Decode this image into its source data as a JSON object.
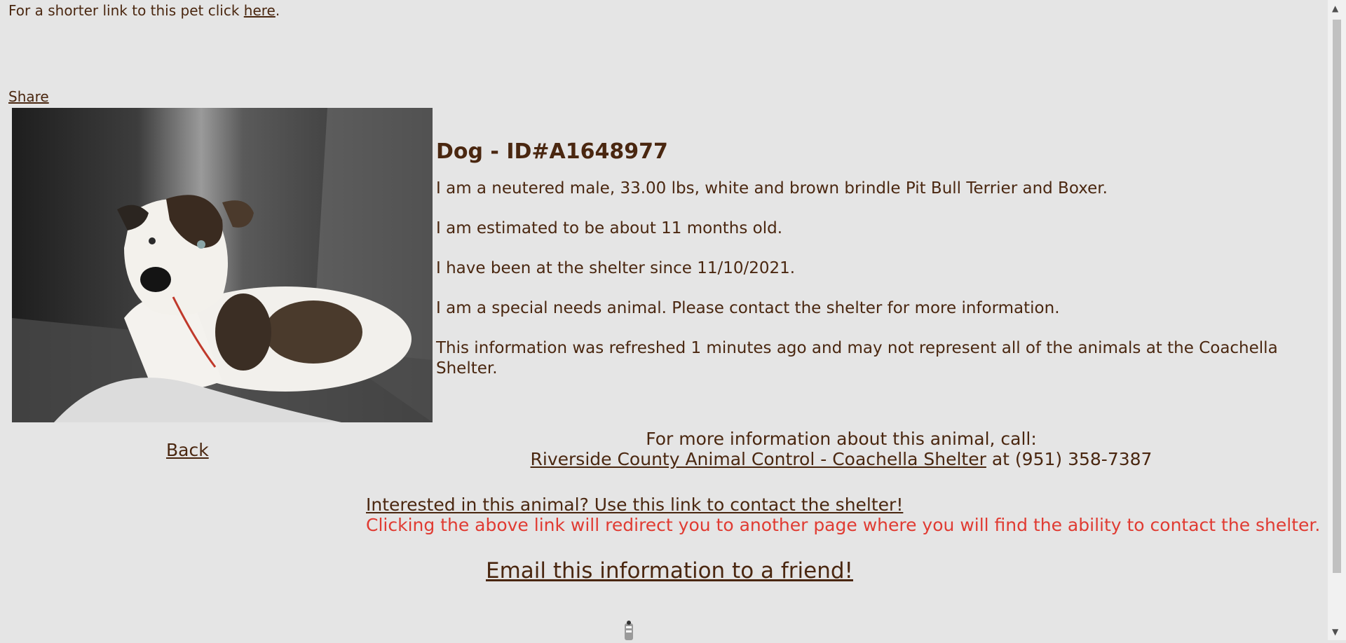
{
  "top": {
    "short_link_prefix": "For a shorter link to this pet click ",
    "short_link_label": "here",
    "short_link_suffix": "."
  },
  "share_label": "Share",
  "animal": {
    "title": "Dog - ID#A1648977",
    "line1": "I am a neutered male, 33.00 lbs, white and brown brindle Pit Bull Terrier and Boxer.",
    "line2": "I am estimated to be about 11 months old.",
    "line3": "I have been at the shelter since 11/10/2021.",
    "line4": "I am a special needs animal. Please contact the shelter for more information.",
    "line5": "This information was refreshed 1 minutes ago and may not represent all of the animals at the Coachella Shelter."
  },
  "back_label": "Back",
  "contact": {
    "call_line": "For more information about this animal, call:",
    "shelter_link": "Riverside County Animal Control - Coachella Shelter",
    "phone_text": " at (951) 358-7387"
  },
  "interest": {
    "link_label": "Interested in this animal? Use this link to contact the shelter!",
    "note": "Clicking the above link will redirect you to another page where you will find the ability to contact the shelter."
  },
  "email_label": "Email this information to a friend!",
  "icons": {
    "photo": "dog-photo",
    "spinner": "loading-icon",
    "scroll_up": "scroll-up-arrow-icon",
    "scroll_down": "scroll-down-arrow-icon"
  },
  "colors": {
    "background": "#e5e5e5",
    "text": "#4a2710",
    "warning": "#e03b32"
  }
}
